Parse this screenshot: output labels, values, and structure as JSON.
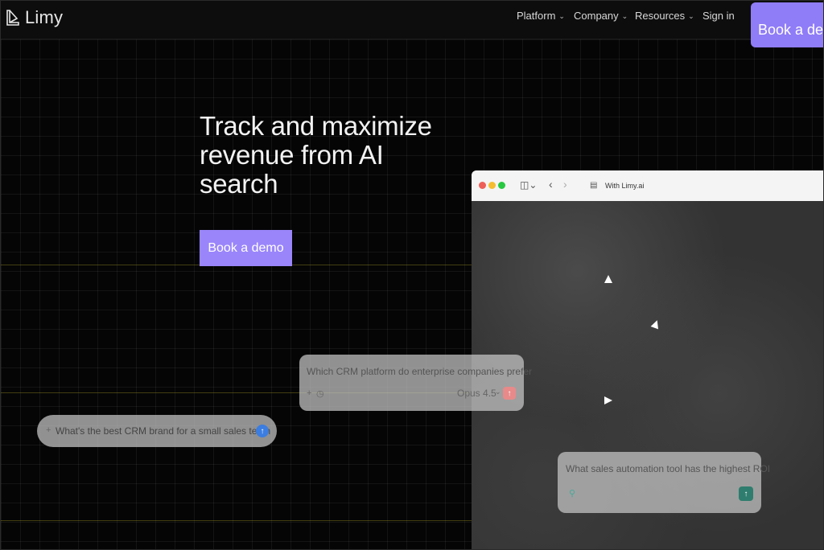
{
  "nav": {
    "logo": "Limy",
    "items": [
      {
        "label": "Platform",
        "chevron": "chevron-down-icon"
      },
      {
        "label": "Company",
        "chevron": "chevron-down-icon"
      },
      {
        "label": "Resources",
        "chevron": "chevron-down-icon"
      }
    ],
    "signin": "Sign in",
    "cta": "Book a demo"
  },
  "hero": {
    "title": "Track and maximize revenue from AI search",
    "button": "Book a demo"
  },
  "browser": {
    "url": "With  Limy.ai"
  },
  "prompts": [
    {
      "text": "Which CRM platform do enterprise companies prefer",
      "model": "Opus 4.5",
      "send_color": "#e88a8a"
    },
    {
      "text": "What's the best CRM brand for a small sales team",
      "send_color": "#3b7de0"
    },
    {
      "text": "What sales automation tool has the highest ROI",
      "send_color": "#2f7d6e"
    }
  ],
  "colors": {
    "accent": "#9a85fb",
    "background": "#050505"
  }
}
